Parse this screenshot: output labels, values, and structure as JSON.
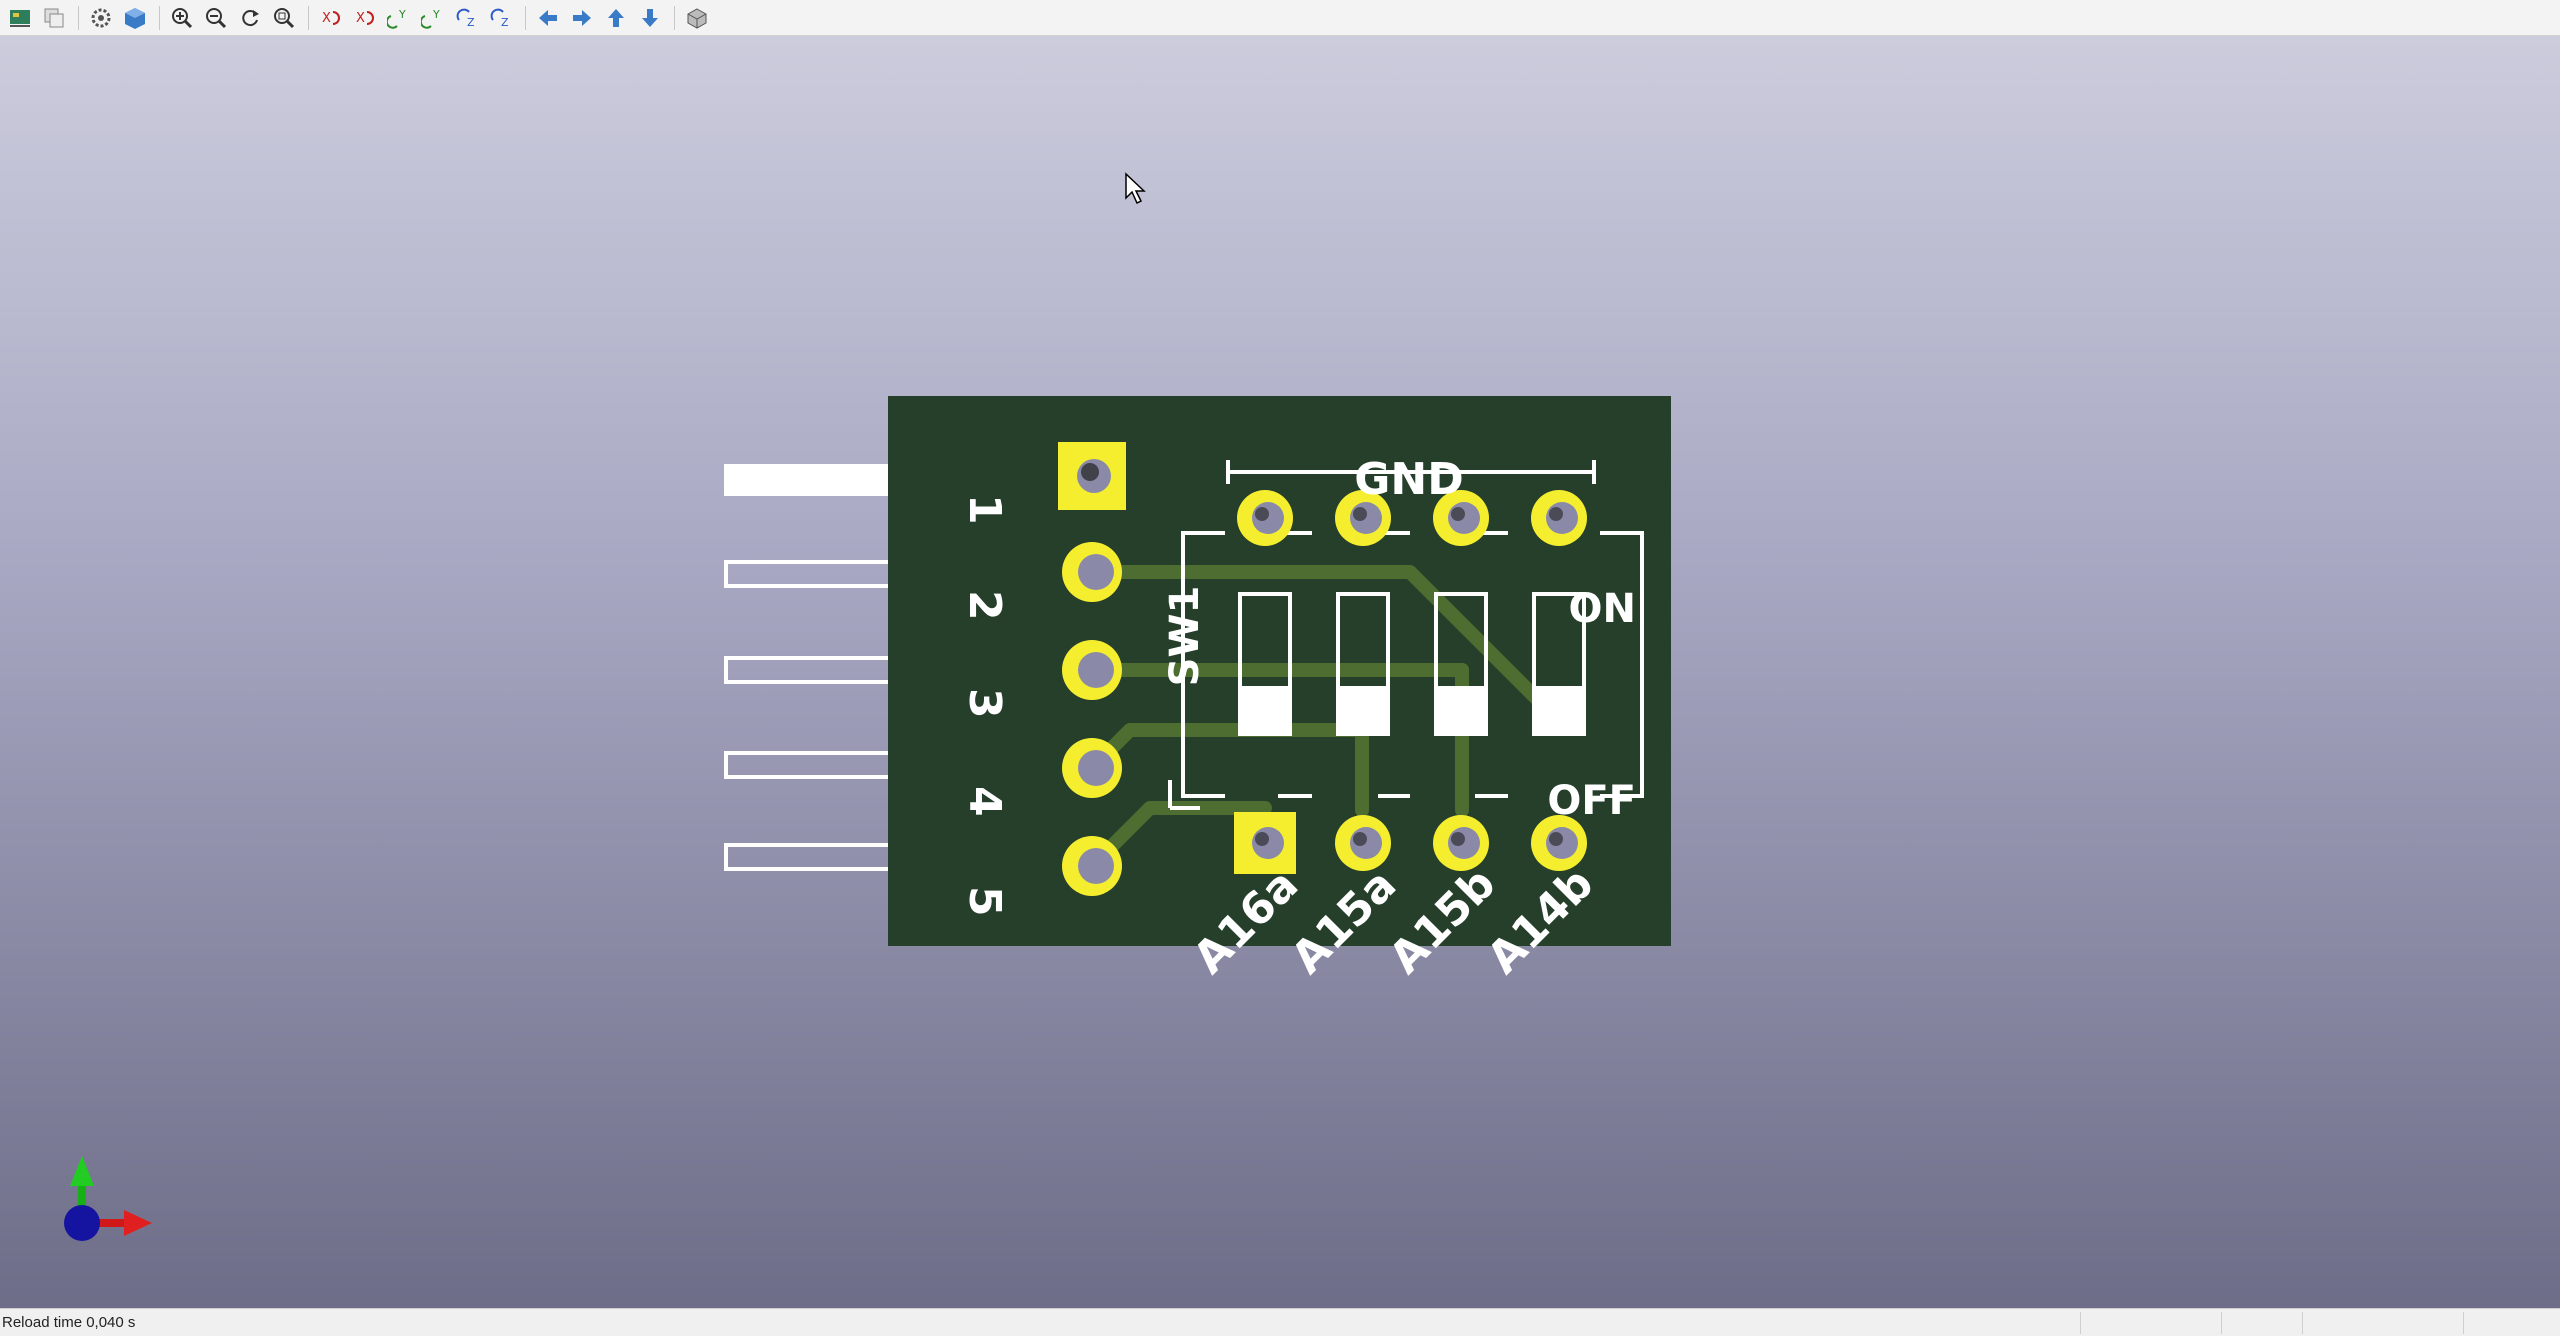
{
  "toolbar": {
    "buttons": [
      {
        "name": "render-options-icon"
      },
      {
        "name": "copy-image-icon"
      },
      {
        "name": "settings-gear-icon"
      },
      {
        "name": "3d-view-icon"
      },
      {
        "name": "zoom-in-icon"
      },
      {
        "name": "zoom-out-icon"
      },
      {
        "name": "redraw-icon"
      },
      {
        "name": "zoom-fit-icon"
      },
      {
        "name": "rotate-x-cw-icon"
      },
      {
        "name": "rotate-x-ccw-icon"
      },
      {
        "name": "rotate-y-cw-icon"
      },
      {
        "name": "rotate-y-ccw-icon"
      },
      {
        "name": "rotate-z-cw-icon"
      },
      {
        "name": "rotate-z-ccw-icon"
      },
      {
        "name": "move-left-icon"
      },
      {
        "name": "move-right-icon"
      },
      {
        "name": "move-up-icon"
      },
      {
        "name": "move-down-icon"
      },
      {
        "name": "orthographic-icon"
      }
    ]
  },
  "pcb": {
    "pin_labels": [
      "1",
      "2",
      "3",
      "4",
      "5"
    ],
    "gnd_label": "GND",
    "ref_label": "SW1",
    "on_label": "ON",
    "off_label": "OFF",
    "signal_labels": [
      "A16a",
      "A15a",
      "A15b",
      "A14b"
    ]
  },
  "colors": {
    "board": "#263f2b",
    "pad": "#f5ee2e",
    "hole": "#8a8aa8",
    "silkscreen": "#ffffff",
    "trace": "#4d6e30"
  },
  "status": {
    "text": "Reload time 0,040 s"
  }
}
